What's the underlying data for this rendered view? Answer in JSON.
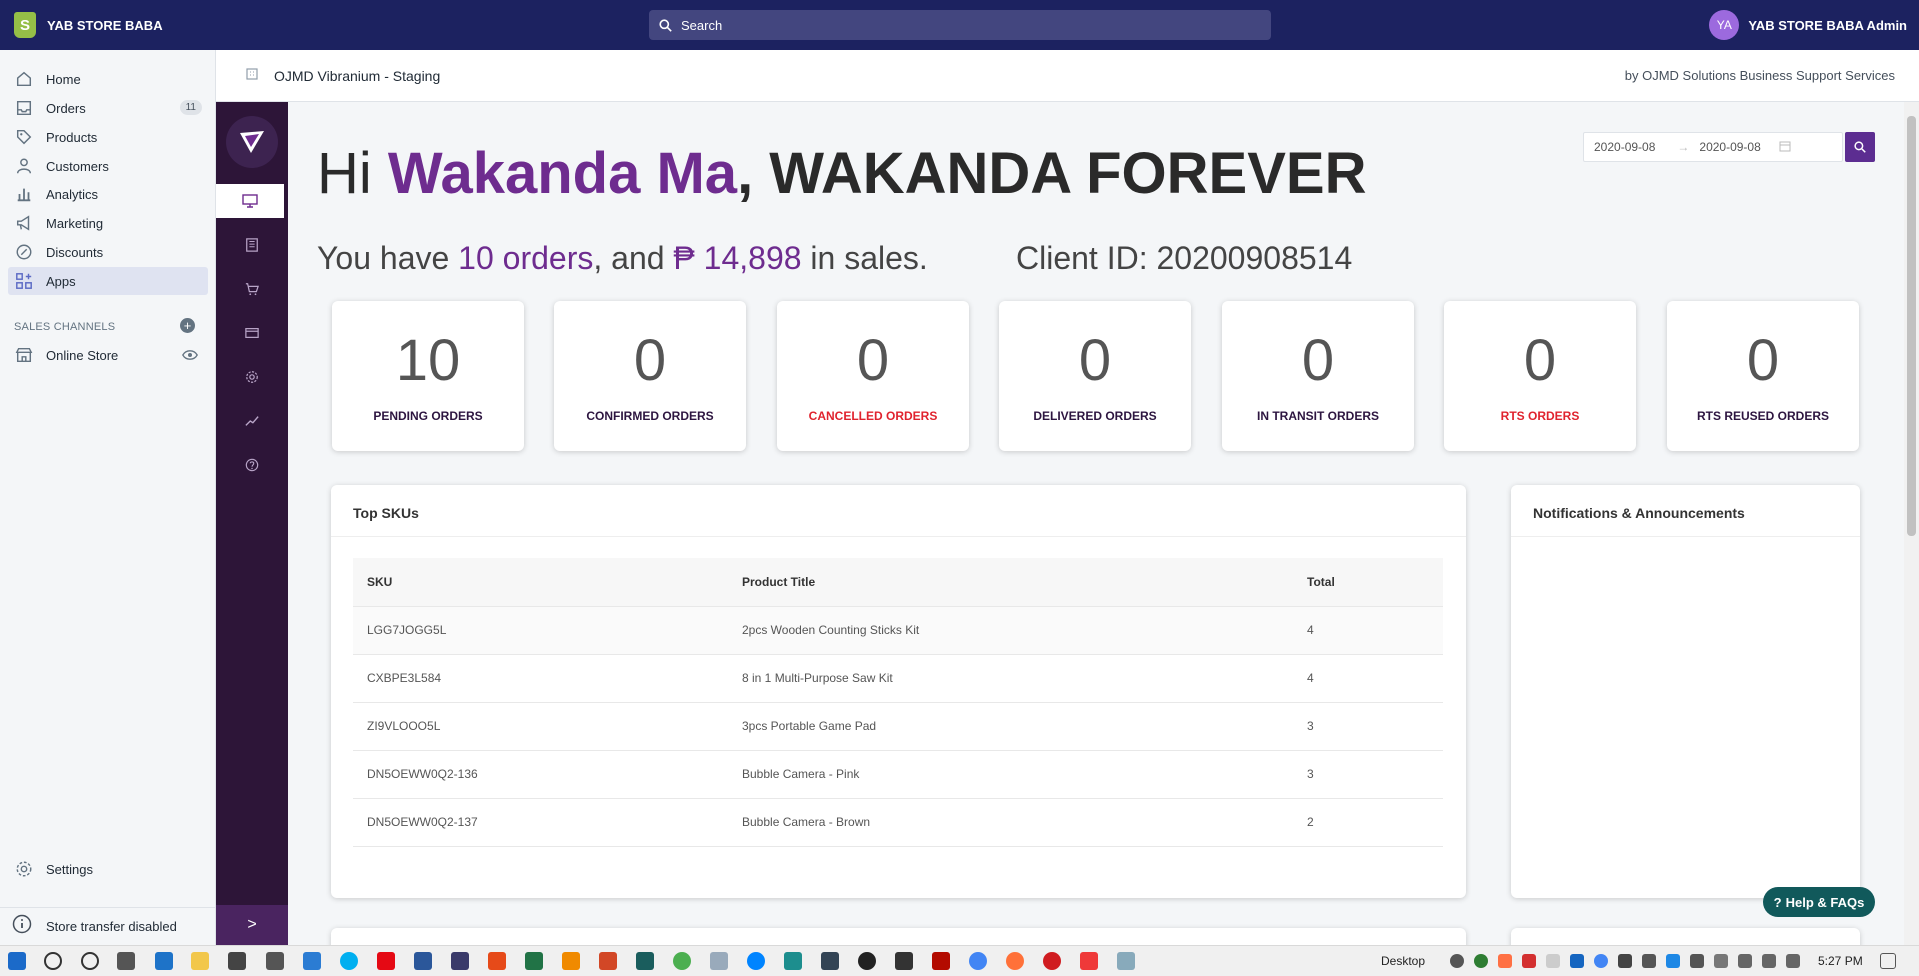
{
  "topbar": {
    "store_name": "YAB STORE BABA",
    "search_placeholder": "Search",
    "avatar_initials": "YA",
    "user_name": "YAB STORE BABA Admin"
  },
  "sidebar": {
    "items": [
      {
        "label": "Home",
        "icon": "home-icon"
      },
      {
        "label": "Orders",
        "icon": "orders-icon",
        "badge": "11"
      },
      {
        "label": "Products",
        "icon": "tag-icon"
      },
      {
        "label": "Customers",
        "icon": "person-icon"
      },
      {
        "label": "Analytics",
        "icon": "bar-chart-icon"
      },
      {
        "label": "Marketing",
        "icon": "megaphone-icon"
      },
      {
        "label": "Discounts",
        "icon": "discount-icon"
      },
      {
        "label": "Apps",
        "icon": "apps-icon",
        "active": true
      }
    ],
    "sales_channels_label": "SALES CHANNELS",
    "online_store_label": "Online Store",
    "settings_label": "Settings",
    "store_transfer_label": "Store transfer disabled"
  },
  "app_header": {
    "title": "OJMD Vibranium - Staging",
    "credit": "by OJMD Solutions Business Support Services"
  },
  "greeting": {
    "prefix": "Hi ",
    "name": "Wakanda Ma",
    "suffix": ", WAKANDA FOREVER"
  },
  "summary": {
    "prefix": "You have ",
    "orders": "10 orders",
    "mid": ", and ",
    "sales": "₱ 14,898",
    "suffix": " in sales.",
    "client_id": "Client ID: 20200908514"
  },
  "date_range": {
    "start": "2020-09-08",
    "end": "2020-09-08"
  },
  "cards": [
    {
      "value": "10",
      "label": "PENDING ORDERS",
      "red": false
    },
    {
      "value": "0",
      "label": "CONFIRMED ORDERS",
      "red": false
    },
    {
      "value": "0",
      "label": "CANCELLED ORDERS",
      "red": true
    },
    {
      "value": "0",
      "label": "DELIVERED ORDERS",
      "red": false
    },
    {
      "value": "0",
      "label": "IN TRANSIT ORDERS",
      "red": false
    },
    {
      "value": "0",
      "label": "RTS ORDERS",
      "red": true
    },
    {
      "value": "0",
      "label": "RTS REUSED ORDERS",
      "red": false
    }
  ],
  "top_skus": {
    "title": "Top SKUs",
    "columns": [
      "SKU",
      "Product Title",
      "Total"
    ],
    "rows": [
      [
        "LGG7JOGG5L",
        "2pcs Wooden Counting Sticks Kit",
        "4"
      ],
      [
        "CXBPE3L584",
        "8 in 1 Multi-Purpose Saw Kit",
        "4"
      ],
      [
        "ZI9VLOOO5L",
        "3pcs Portable Game Pad",
        "3"
      ],
      [
        "DN5OEWW0Q2-136",
        "Bubble Camera - Pink",
        "3"
      ],
      [
        "DN5OEWW0Q2-137",
        "Bubble Camera - Brown",
        "2"
      ]
    ]
  },
  "notifications": {
    "title": "Notifications & Announcements"
  },
  "help_button": "Help & FAQs",
  "taskbar": {
    "desktop_label": "Desktop",
    "time": "5:27 PM"
  },
  "colors": {
    "topbar": "#1c2260",
    "accent_purple": "#6e2c8f",
    "app_sidebar": "#2d1538",
    "alert_red": "#e0232e",
    "help_teal": "#11595b"
  }
}
